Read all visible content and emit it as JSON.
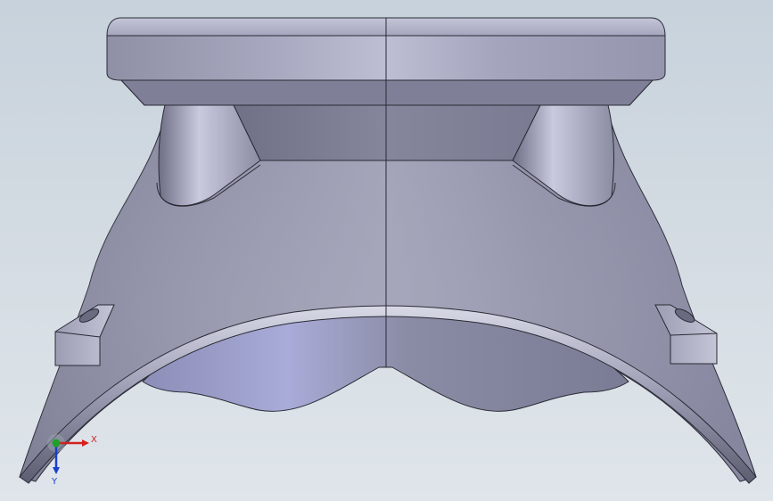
{
  "viewport": {
    "background_top": "#c7d2dc",
    "background_bottom": "#dfe5ea"
  },
  "model": {
    "part_color": "#8e8fa8",
    "highlight_color": "#b9bad0",
    "shadow_color": "#6a6b80",
    "edge_color": "#2a2a35"
  },
  "triad": {
    "x_label": "X",
    "y_label": "Y",
    "x_color": "#d42020",
    "y_color": "#1a3fd0",
    "origin_color": "#1fa02a"
  }
}
